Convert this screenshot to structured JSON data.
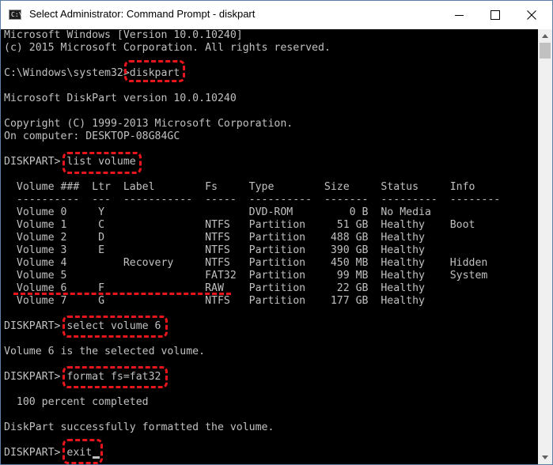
{
  "window": {
    "title": "Select Administrator: Command Prompt - diskpart",
    "icon_label": "C:\\"
  },
  "console": {
    "lines": [
      "Microsoft Windows [Version 10.0.10240]",
      "(c) 2015 Microsoft Corporation. All rights reserved.",
      "",
      "C:\\Windows\\system32>diskpart",
      "",
      "Microsoft DiskPart version 10.0.10240",
      "",
      "Copyright (C) 1999-2013 Microsoft Corporation.",
      "On computer: DESKTOP-08G84GC",
      "",
      "DISKPART> list volume",
      "",
      "  Volume ###  Ltr  Label        Fs     Type        Size     Status     Info",
      "  ----------  ---  -----------  -----  ----------  -------  ---------  --------",
      "  Volume 0     Y                       DVD-ROM         0 B  No Media",
      "  Volume 1     C                NTFS   Partition     51 GB  Healthy    Boot",
      "  Volume 2     D                NTFS   Partition    488 GB  Healthy",
      "  Volume 3     E                NTFS   Partition    390 GB  Healthy",
      "  Volume 4         Recovery     NTFS   Partition    450 MB  Healthy    Hidden",
      "  Volume 5                      FAT32  Partition     99 MB  Healthy    System",
      "  Volume 6     F                RAW    Partition     22 GB  Healthy",
      "  Volume 7     G                NTFS   Partition    177 GB  Healthy",
      "",
      "DISKPART> select volume 6",
      "",
      "Volume 6 is the selected volume.",
      "",
      "DISKPART> format fs=fat32",
      "",
      "  100 percent completed",
      "",
      "DiskPart successfully formatted the volume.",
      "",
      "DISKPART> exit"
    ]
  },
  "annotation_color": "#e8151b"
}
